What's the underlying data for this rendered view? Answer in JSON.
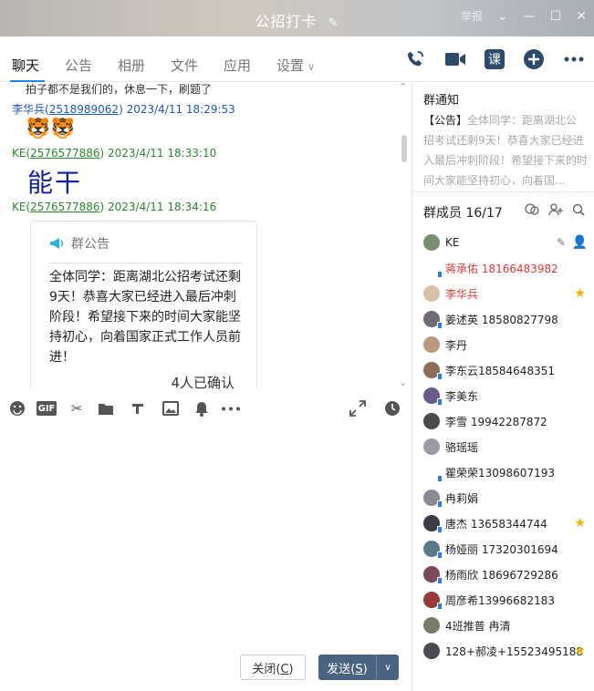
{
  "window": {
    "title": "公招打卡",
    "report_label": "举报"
  },
  "tabs": [
    {
      "label": "聊天"
    },
    {
      "label": "公告"
    },
    {
      "label": "相册"
    },
    {
      "label": "文件"
    },
    {
      "label": "应用"
    },
    {
      "label": "设置"
    }
  ],
  "chat": {
    "partial_message": "拍子都不是我们的，休息一下，刷题了",
    "messages": [
      {
        "sender": "李华兵",
        "uid": "2518989062",
        "time": "2023/4/11 18:29:53",
        "content": "🐯🐯"
      },
      {
        "sender": "KE",
        "uid": "2576577886",
        "time": "2023/4/11 18:33:10",
        "content": "能干"
      },
      {
        "sender": "KE",
        "uid": "2576577886",
        "time": "2023/4/11 18:34:16"
      }
    ],
    "notice_card": {
      "header": "群公告",
      "body": "全体同学：距离湖北公招考试还剩9天！恭喜大家已经进入最后冲刺阶段！希望接下来的时间大家能坚持初心，向着国家正式工作人员前进！",
      "confirm": "4人已确认"
    }
  },
  "buttons": {
    "close": "关闭(C)",
    "close_key": "C",
    "send": "发送(S)",
    "send_key": "S"
  },
  "group_notice": {
    "title": "群通知",
    "label": "【公告】",
    "text": "全体同学：距离湖北公招考试还剩9天！恭喜大家已经进入最后冲刺阶段！希望接下来的时间大家能坚持初心，向着国..."
  },
  "members": {
    "title": "群成员 16/17",
    "list": [
      {
        "name": "KE",
        "icon": "avatar"
      },
      {
        "name": "蒋承佑 18166483982",
        "icon": "mobile"
      },
      {
        "name": "李华兵",
        "icon": "avatar"
      },
      {
        "name": "姜述英 18580827798",
        "icon": "avatar"
      },
      {
        "name": "李丹",
        "icon": "avatar"
      },
      {
        "name": "李东云18584648351",
        "icon": "avatar"
      },
      {
        "name": "李美东",
        "icon": "avatar"
      },
      {
        "name": "李雪  19942287872",
        "icon": "avatar"
      },
      {
        "name": "骆瑶瑶",
        "icon": "avatar"
      },
      {
        "name": "瞿荣荣13098607193",
        "icon": "mobile"
      },
      {
        "name": "冉莉娟",
        "icon": "avatar"
      },
      {
        "name": "唐杰  13658344744",
        "icon": "avatar"
      },
      {
        "name": "杨娅丽 17320301694",
        "icon": "avatar"
      },
      {
        "name": "杨雨欣   18696729286",
        "icon": "avatar"
      },
      {
        "name": "周彦希13996682183",
        "icon": "avatar"
      },
      {
        "name": "4班推普 冉清",
        "icon": "avatar"
      },
      {
        "name": "128+郝凌+15523495188",
        "icon": "avatar"
      }
    ]
  }
}
